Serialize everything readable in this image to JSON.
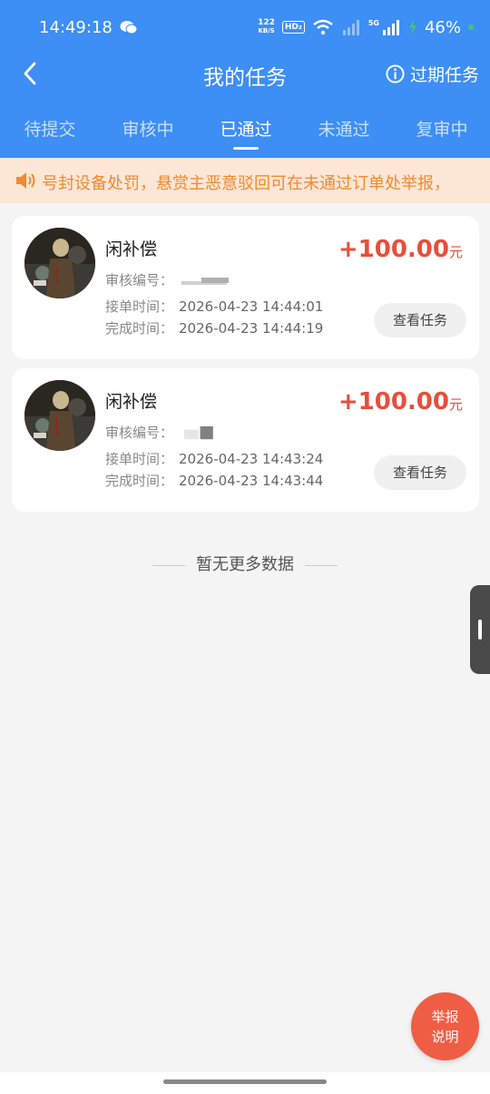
{
  "status_bar": {
    "time": "14:49:18",
    "net_speed_value": "122",
    "net_speed_unit": "KB/S",
    "hd_label": "HD₂",
    "network_label": "5G",
    "battery": "46%"
  },
  "header": {
    "title": "我的任务",
    "expired_label": "过期任务"
  },
  "tabs": [
    {
      "label": "待提交"
    },
    {
      "label": "审核中"
    },
    {
      "label": "已通过"
    },
    {
      "label": "未通过"
    },
    {
      "label": "复审中"
    }
  ],
  "active_tab": "已通过",
  "notice": {
    "text": "号封设备处罚，悬赏主恶意驳回可在未通过订单处举报，"
  },
  "labels": {
    "review_no": "审核编号：",
    "accept_time": "接单时间：",
    "finish_time": "完成时间：",
    "view_button": "查看任务",
    "currency_unit": "元"
  },
  "tasks": [
    {
      "title": "闲补偿",
      "reward": "+100.00",
      "accept_time": "2026-04-23 14:44:01",
      "finish_time": "2026-04-23 14:44:19"
    },
    {
      "title": "闲补偿",
      "reward": "+100.00",
      "accept_time": "2026-04-23 14:43:24",
      "finish_time": "2026-04-23 14:43:44"
    }
  ],
  "no_more": "暂无更多数据",
  "report_fab": {
    "line1": "举报",
    "line2": "说明"
  },
  "colors": {
    "header_bg": "#3d8ef5",
    "notice_bg": "#fce6d6",
    "notice_text": "#f28a2e",
    "reward": "#e94e3c",
    "fab": "#ef5d45"
  }
}
